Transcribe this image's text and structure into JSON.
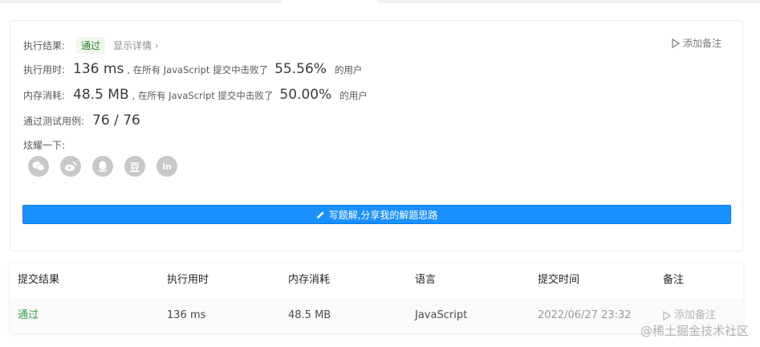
{
  "result": {
    "status_label": "执行结果:",
    "status_value": "通过",
    "details_link": "显示详情 ›",
    "add_note": "添加备注",
    "runtime": {
      "label": "执行用时:",
      "value": "136 ms",
      "mid_text": ", 在所有 JavaScript 提交中击败了",
      "percent": "55.56%",
      "suffix": "的用户"
    },
    "memory": {
      "label": "内存消耗:",
      "value": "48.5 MB",
      "mid_text": ", 在所有 JavaScript 提交中击败了",
      "percent": "50.00%",
      "suffix": "的用户"
    },
    "tests": {
      "label": "通过测试用例:",
      "value": "76 / 76"
    },
    "share_label": "炫耀一下:",
    "share_icons": [
      "wechat-icon",
      "weibo-icon",
      "qq-icon",
      "douban-icon",
      "linkedin-icon"
    ],
    "write_button": "写题解,分享我的解题思路"
  },
  "submissions": {
    "headers": [
      "提交结果",
      "执行用时",
      "内存消耗",
      "语言",
      "提交时间",
      "备注"
    ],
    "rows": [
      {
        "result": "通过",
        "runtime": "136 ms",
        "memory": "48.5 MB",
        "language": "JavaScript",
        "time": "2022/06/27 23:32",
        "note": "添加备注"
      }
    ]
  },
  "watermark": "@稀土掘金技术社区",
  "colors": {
    "accent": "#1a90ff",
    "pass": "#3aa14a",
    "icon_gray": "#c8c8c8"
  }
}
